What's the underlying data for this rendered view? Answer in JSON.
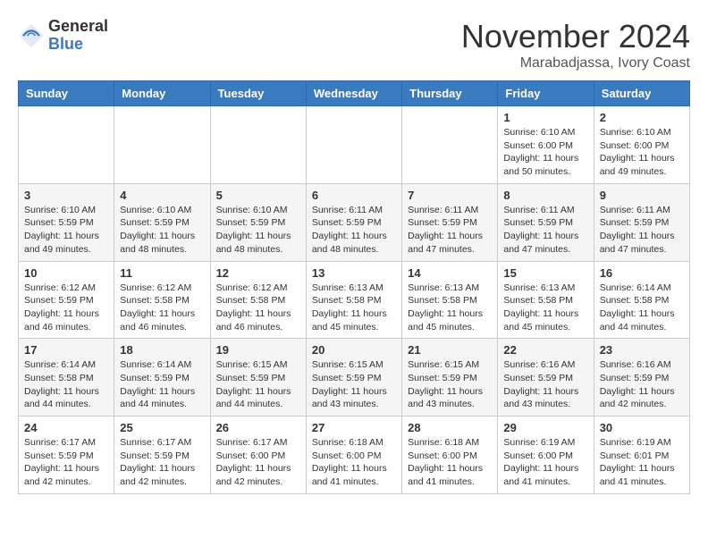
{
  "header": {
    "logo_general": "General",
    "logo_blue": "Blue",
    "month_year": "November 2024",
    "location": "Marabadjassa, Ivory Coast"
  },
  "weekdays": [
    "Sunday",
    "Monday",
    "Tuesday",
    "Wednesday",
    "Thursday",
    "Friday",
    "Saturday"
  ],
  "weeks": [
    [
      {
        "day": "",
        "info": ""
      },
      {
        "day": "",
        "info": ""
      },
      {
        "day": "",
        "info": ""
      },
      {
        "day": "",
        "info": ""
      },
      {
        "day": "",
        "info": ""
      },
      {
        "day": "1",
        "info": "Sunrise: 6:10 AM\nSunset: 6:00 PM\nDaylight: 11 hours\nand 50 minutes."
      },
      {
        "day": "2",
        "info": "Sunrise: 6:10 AM\nSunset: 6:00 PM\nDaylight: 11 hours\nand 49 minutes."
      }
    ],
    [
      {
        "day": "3",
        "info": "Sunrise: 6:10 AM\nSunset: 5:59 PM\nDaylight: 11 hours\nand 49 minutes."
      },
      {
        "day": "4",
        "info": "Sunrise: 6:10 AM\nSunset: 5:59 PM\nDaylight: 11 hours\nand 48 minutes."
      },
      {
        "day": "5",
        "info": "Sunrise: 6:10 AM\nSunset: 5:59 PM\nDaylight: 11 hours\nand 48 minutes."
      },
      {
        "day": "6",
        "info": "Sunrise: 6:11 AM\nSunset: 5:59 PM\nDaylight: 11 hours\nand 48 minutes."
      },
      {
        "day": "7",
        "info": "Sunrise: 6:11 AM\nSunset: 5:59 PM\nDaylight: 11 hours\nand 47 minutes."
      },
      {
        "day": "8",
        "info": "Sunrise: 6:11 AM\nSunset: 5:59 PM\nDaylight: 11 hours\nand 47 minutes."
      },
      {
        "day": "9",
        "info": "Sunrise: 6:11 AM\nSunset: 5:59 PM\nDaylight: 11 hours\nand 47 minutes."
      }
    ],
    [
      {
        "day": "10",
        "info": "Sunrise: 6:12 AM\nSunset: 5:59 PM\nDaylight: 11 hours\nand 46 minutes."
      },
      {
        "day": "11",
        "info": "Sunrise: 6:12 AM\nSunset: 5:58 PM\nDaylight: 11 hours\nand 46 minutes."
      },
      {
        "day": "12",
        "info": "Sunrise: 6:12 AM\nSunset: 5:58 PM\nDaylight: 11 hours\nand 46 minutes."
      },
      {
        "day": "13",
        "info": "Sunrise: 6:13 AM\nSunset: 5:58 PM\nDaylight: 11 hours\nand 45 minutes."
      },
      {
        "day": "14",
        "info": "Sunrise: 6:13 AM\nSunset: 5:58 PM\nDaylight: 11 hours\nand 45 minutes."
      },
      {
        "day": "15",
        "info": "Sunrise: 6:13 AM\nSunset: 5:58 PM\nDaylight: 11 hours\nand 45 minutes."
      },
      {
        "day": "16",
        "info": "Sunrise: 6:14 AM\nSunset: 5:58 PM\nDaylight: 11 hours\nand 44 minutes."
      }
    ],
    [
      {
        "day": "17",
        "info": "Sunrise: 6:14 AM\nSunset: 5:58 PM\nDaylight: 11 hours\nand 44 minutes."
      },
      {
        "day": "18",
        "info": "Sunrise: 6:14 AM\nSunset: 5:59 PM\nDaylight: 11 hours\nand 44 minutes."
      },
      {
        "day": "19",
        "info": "Sunrise: 6:15 AM\nSunset: 5:59 PM\nDaylight: 11 hours\nand 44 minutes."
      },
      {
        "day": "20",
        "info": "Sunrise: 6:15 AM\nSunset: 5:59 PM\nDaylight: 11 hours\nand 43 minutes."
      },
      {
        "day": "21",
        "info": "Sunrise: 6:15 AM\nSunset: 5:59 PM\nDaylight: 11 hours\nand 43 minutes."
      },
      {
        "day": "22",
        "info": "Sunrise: 6:16 AM\nSunset: 5:59 PM\nDaylight: 11 hours\nand 43 minutes."
      },
      {
        "day": "23",
        "info": "Sunrise: 6:16 AM\nSunset: 5:59 PM\nDaylight: 11 hours\nand 42 minutes."
      }
    ],
    [
      {
        "day": "24",
        "info": "Sunrise: 6:17 AM\nSunset: 5:59 PM\nDaylight: 11 hours\nand 42 minutes."
      },
      {
        "day": "25",
        "info": "Sunrise: 6:17 AM\nSunset: 5:59 PM\nDaylight: 11 hours\nand 42 minutes."
      },
      {
        "day": "26",
        "info": "Sunrise: 6:17 AM\nSunset: 6:00 PM\nDaylight: 11 hours\nand 42 minutes."
      },
      {
        "day": "27",
        "info": "Sunrise: 6:18 AM\nSunset: 6:00 PM\nDaylight: 11 hours\nand 41 minutes."
      },
      {
        "day": "28",
        "info": "Sunrise: 6:18 AM\nSunset: 6:00 PM\nDaylight: 11 hours\nand 41 minutes."
      },
      {
        "day": "29",
        "info": "Sunrise: 6:19 AM\nSunset: 6:00 PM\nDaylight: 11 hours\nand 41 minutes."
      },
      {
        "day": "30",
        "info": "Sunrise: 6:19 AM\nSunset: 6:01 PM\nDaylight: 11 hours\nand 41 minutes."
      }
    ]
  ]
}
